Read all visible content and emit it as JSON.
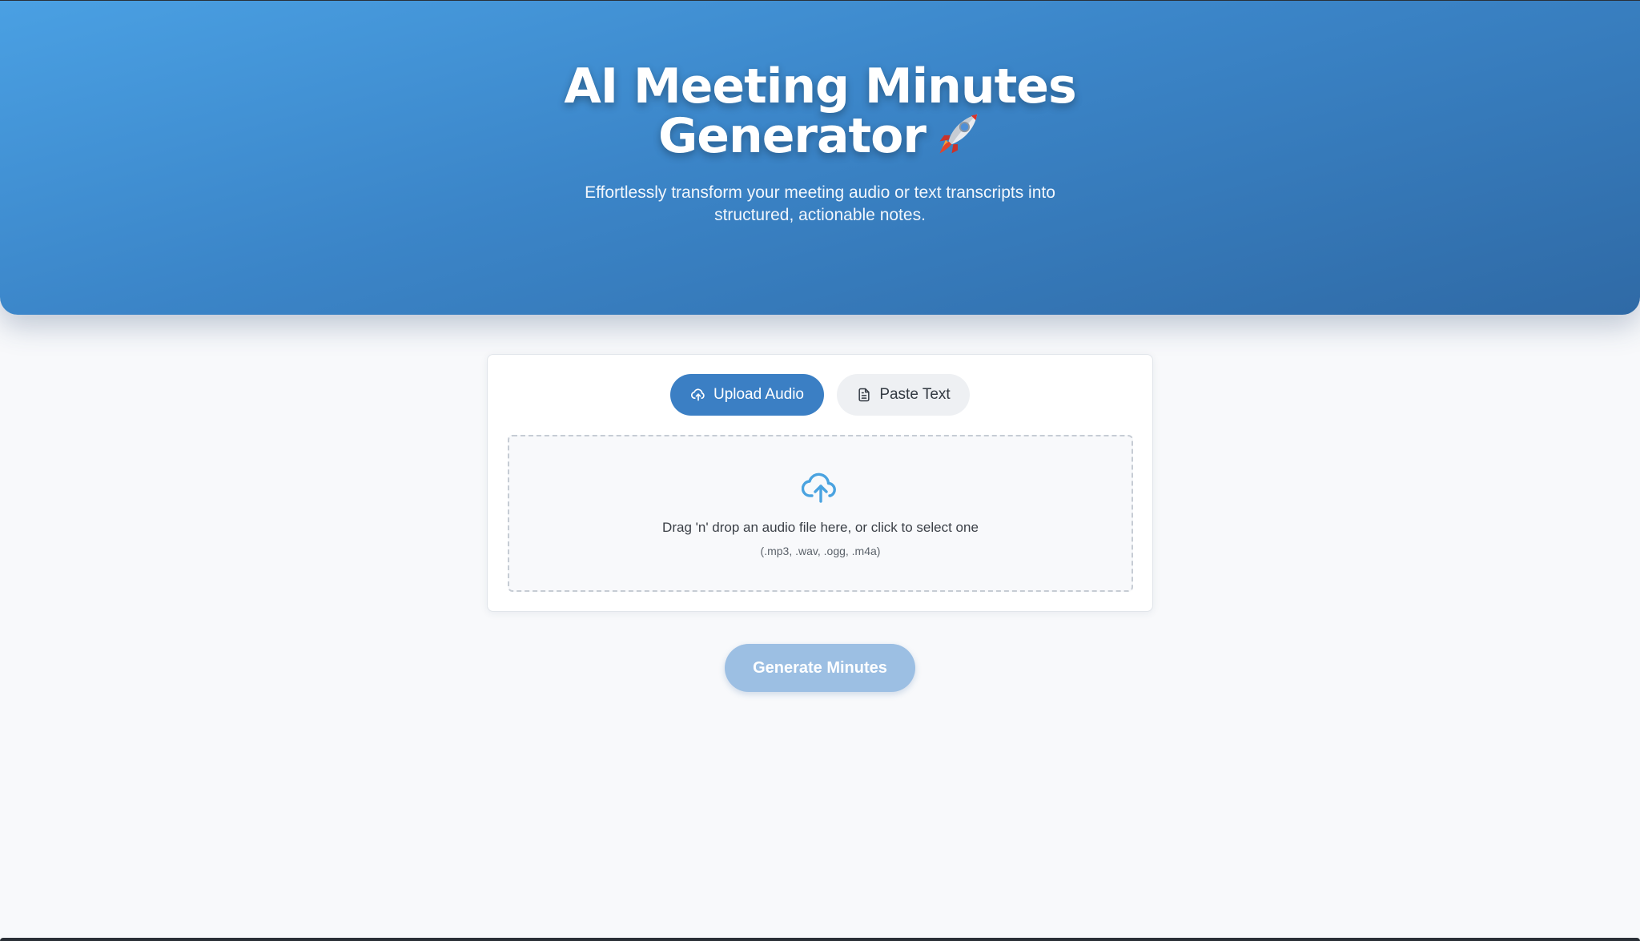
{
  "header": {
    "title_line1": "AI Meeting Minutes",
    "title_line2": "Generator",
    "title_emoji_icon": "rocket-icon",
    "subtitle_line1": "Effortlessly transform your meeting audio or text transcripts into",
    "subtitle_line2": "structured, actionable notes."
  },
  "tabs": [
    {
      "label": "Upload Audio",
      "icon": "cloud-upload-icon",
      "active": true
    },
    {
      "label": "Paste Text",
      "icon": "document-icon",
      "active": false
    }
  ],
  "dropzone": {
    "icon": "cloud-upload-icon",
    "text": "Drag 'n' drop an audio file here, or click to select one",
    "hint": "(.mp3, .wav, .ogg, .m4a)"
  },
  "generate_button": {
    "label": "Generate Minutes",
    "disabled": true
  },
  "colors": {
    "hero_gradient_start": "#4aa0e3",
    "hero_gradient_end": "#2f6aa6",
    "accent": "#3b7fc4",
    "button_disabled": "#9cbfe3",
    "background": "#f8f9fb"
  }
}
